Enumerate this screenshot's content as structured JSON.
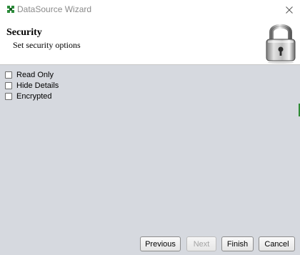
{
  "window": {
    "title": "DataSource Wizard"
  },
  "header": {
    "title": "Security",
    "subtitle": "Set security options",
    "image_icon": "padlock-icon"
  },
  "options": [
    {
      "label": "Read Only",
      "checked": false
    },
    {
      "label": "Hide Details",
      "checked": false
    },
    {
      "label": "Encrypted",
      "checked": false
    }
  ],
  "buttons": {
    "previous": "Previous",
    "next": "Next",
    "finish": "Finish",
    "cancel": "Cancel"
  },
  "colors": {
    "content_bg": "#d6d9df",
    "accent_green": "#2f8a35"
  }
}
